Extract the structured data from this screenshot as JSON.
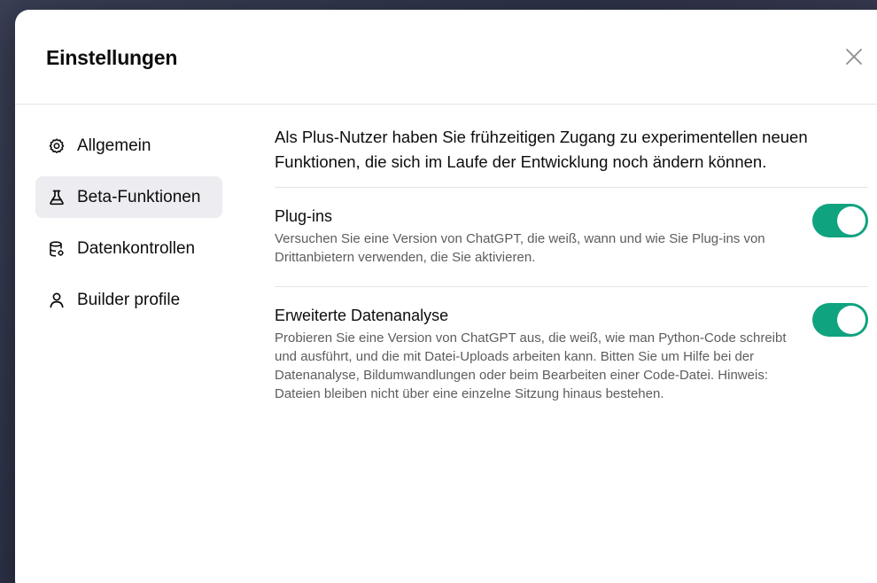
{
  "modal": {
    "title": "Einstellungen"
  },
  "sidebar": {
    "items": [
      {
        "label": "Allgemein",
        "icon": "gear-icon",
        "active": false
      },
      {
        "label": "Beta-Funktionen",
        "icon": "flask-icon",
        "active": true
      },
      {
        "label": "Datenkontrollen",
        "icon": "database-icon",
        "active": false
      },
      {
        "label": "Builder profile",
        "icon": "user-icon",
        "active": false
      }
    ]
  },
  "content": {
    "intro": "Als Plus-Nutzer haben Sie frühzeitigen Zugang zu experimentellen neuen Funktionen, die sich im Laufe der Entwicklung noch ändern können.",
    "features": [
      {
        "title": "Plug-ins",
        "description": "Versuchen Sie eine Version von ChatGPT, die weiß, wann und wie Sie Plug-ins von Drittanbietern verwenden, die Sie aktivieren.",
        "enabled": true
      },
      {
        "title": "Erweiterte Datenanalyse",
        "description": "Probieren Sie eine Version von ChatGPT aus, die weiß, wie man Python-Code schreibt und ausführt, und die mit Datei-Uploads arbeiten kann. Bitten Sie um Hilfe bei der Datenanalyse, Bildumwandlungen oder beim Bearbeiten einer Code-Datei. Hinweis: Dateien bleiben nicht über eine einzelne Sitzung hinaus bestehen.",
        "enabled": true
      }
    ]
  },
  "colors": {
    "accent": "#10a37f",
    "active_nav_bg": "#ececf1"
  }
}
